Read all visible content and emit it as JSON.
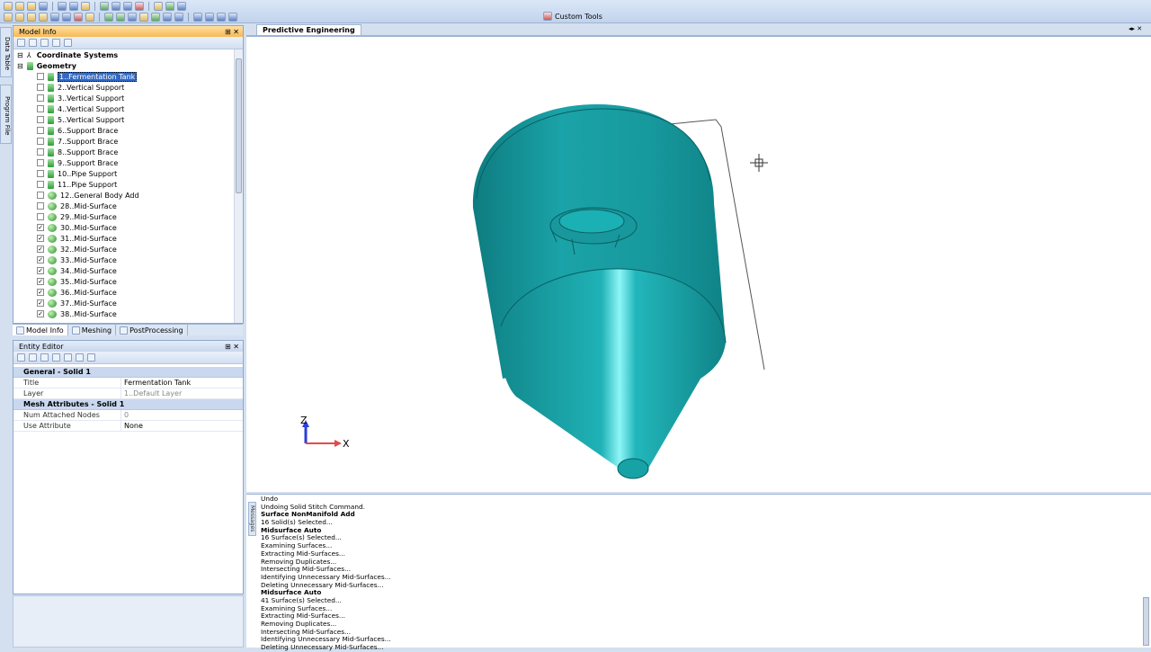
{
  "toolbar": {
    "custom_tools_label": "Custom Tools"
  },
  "side_tabs": {
    "data_table": "Data Table",
    "program_file": "Program File"
  },
  "model_info": {
    "title": "Model Info",
    "tree": [
      {
        "label": "Coordinate Systems",
        "level": 0,
        "bold": true,
        "icon": "axes-icon"
      },
      {
        "label": "Geometry",
        "level": 0,
        "bold": true,
        "icon": "solid-icon"
      },
      {
        "label": "1..Fermentation Tank",
        "level": 1,
        "checked": false,
        "selected": true,
        "icon": "solid-icon"
      },
      {
        "label": "2..Vertical Support",
        "level": 1,
        "checked": false,
        "icon": "solid-icon"
      },
      {
        "label": "3..Vertical Support",
        "level": 1,
        "checked": false,
        "icon": "solid-icon"
      },
      {
        "label": "4..Vertical Support",
        "level": 1,
        "checked": false,
        "icon": "solid-icon"
      },
      {
        "label": "5..Vertical Support",
        "level": 1,
        "checked": false,
        "icon": "solid-icon"
      },
      {
        "label": "6..Support Brace",
        "level": 1,
        "checked": false,
        "icon": "solid-icon"
      },
      {
        "label": "7..Support Brace",
        "level": 1,
        "checked": false,
        "icon": "solid-icon"
      },
      {
        "label": "8..Support Brace",
        "level": 1,
        "checked": false,
        "icon": "solid-icon"
      },
      {
        "label": "9..Support Brace",
        "level": 1,
        "checked": false,
        "icon": "solid-icon"
      },
      {
        "label": "10..Pipe Support",
        "level": 1,
        "checked": false,
        "icon": "solid-icon"
      },
      {
        "label": "11..Pipe Support",
        "level": 1,
        "checked": false,
        "icon": "solid-icon"
      },
      {
        "label": "12..General Body Add",
        "level": 1,
        "checked": false,
        "icon": "midsurface-icon"
      },
      {
        "label": "28..Mid-Surface",
        "level": 1,
        "checked": false,
        "icon": "midsurface-icon"
      },
      {
        "label": "29..Mid-Surface",
        "level": 1,
        "checked": false,
        "icon": "midsurface-icon"
      },
      {
        "label": "30..Mid-Surface",
        "level": 1,
        "checked": true,
        "icon": "midsurface-icon"
      },
      {
        "label": "31..Mid-Surface",
        "level": 1,
        "checked": true,
        "icon": "midsurface-icon"
      },
      {
        "label": "32..Mid-Surface",
        "level": 1,
        "checked": true,
        "icon": "midsurface-icon"
      },
      {
        "label": "33..Mid-Surface",
        "level": 1,
        "checked": true,
        "icon": "midsurface-icon"
      },
      {
        "label": "34..Mid-Surface",
        "level": 1,
        "checked": true,
        "icon": "midsurface-icon"
      },
      {
        "label": "35..Mid-Surface",
        "level": 1,
        "checked": true,
        "icon": "midsurface-icon"
      },
      {
        "label": "36..Mid-Surface",
        "level": 1,
        "checked": true,
        "icon": "midsurface-icon"
      },
      {
        "label": "37..Mid-Surface",
        "level": 1,
        "checked": true,
        "icon": "midsurface-icon"
      },
      {
        "label": "38..Mid-Surface",
        "level": 1,
        "checked": true,
        "icon": "midsurface-icon"
      }
    ],
    "tabs": [
      "Model Info",
      "Meshing",
      "PostProcessing"
    ]
  },
  "entity_editor": {
    "title": "Entity Editor",
    "sections": [
      {
        "header": "General - Solid 1",
        "rows": [
          {
            "key": "Title",
            "value": "Fermentation Tank",
            "muted": false
          },
          {
            "key": "Layer",
            "value": "1..Default Layer",
            "muted": true
          }
        ]
      },
      {
        "header": "Mesh Attributes - Solid 1",
        "rows": [
          {
            "key": "Num Attached Nodes",
            "value": "0",
            "muted": true
          },
          {
            "key": "Use Attribute",
            "value": "None",
            "muted": false
          }
        ]
      }
    ]
  },
  "view": {
    "tab_label": "Predictive Engineering",
    "axis_labels": {
      "z": "Z",
      "x": "X"
    },
    "model_color": "#1aa3a8"
  },
  "messages": {
    "tab_label": "Messages",
    "lines": [
      {
        "text": "Undo",
        "bold": false
      },
      {
        "text": "Undoing Solid Stitch Command.",
        "bold": false
      },
      {
        "text": "Surface NonManifold Add",
        "bold": true
      },
      {
        "text": "16 Solid(s) Selected...",
        "bold": false
      },
      {
        "text": "Midsurface Auto",
        "bold": true
      },
      {
        "text": "16 Surface(s) Selected...",
        "bold": false
      },
      {
        "text": "Examining Surfaces...",
        "bold": false
      },
      {
        "text": "Extracting Mid-Surfaces...",
        "bold": false
      },
      {
        "text": "Removing Duplicates...",
        "bold": false
      },
      {
        "text": "Intersecting Mid-Surfaces...",
        "bold": false
      },
      {
        "text": "Identifying Unnecessary Mid-Surfaces...",
        "bold": false
      },
      {
        "text": "Deleting Unnecessary Mid-Surfaces...",
        "bold": false
      },
      {
        "text": "Midsurface Auto",
        "bold": true
      },
      {
        "text": "41 Surface(s) Selected...",
        "bold": false
      },
      {
        "text": "Examining Surfaces...",
        "bold": false
      },
      {
        "text": "Extracting Mid-Surfaces...",
        "bold": false
      },
      {
        "text": "Removing Duplicates...",
        "bold": false
      },
      {
        "text": "Intersecting Mid-Surfaces...",
        "bold": false
      },
      {
        "text": "Identifying Unnecessary Mid-Surfaces...",
        "bold": false
      },
      {
        "text": "Deleting Unnecessary Mid-Surfaces...",
        "bold": false
      }
    ]
  }
}
